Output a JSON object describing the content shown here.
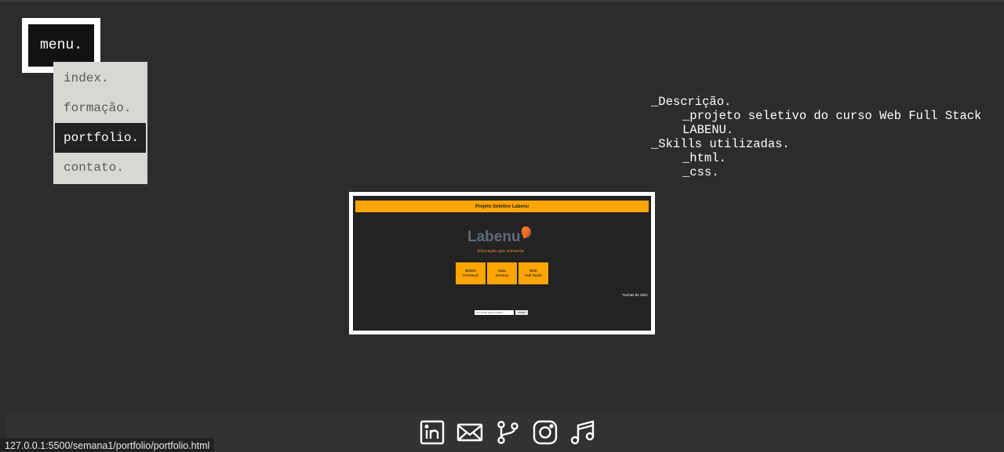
{
  "menu": {
    "button_label": "menu.",
    "items": [
      {
        "label": "index.",
        "active": false
      },
      {
        "label": "formação.",
        "active": false
      },
      {
        "label": "portfolio.",
        "active": true
      },
      {
        "label": "contato.",
        "active": false
      }
    ]
  },
  "description": {
    "heading": "_Descrição.",
    "line1": "_projeto seletivo do curso Web Full Stack",
    "line2": "LABENU.",
    "skills_heading": "_Skills utilizadas.",
    "skill1": "_html.",
    "skill2": "_css."
  },
  "preview": {
    "header_title": "Projeto Seletivo Labenu",
    "logo_text": "Labenu",
    "tagline": "Educação que reinventa",
    "buttons": [
      {
        "line1": "Mobile",
        "line2": "Frontend"
      },
      {
        "line1": "Data",
        "line2": "Science"
      },
      {
        "line1": "Web",
        "line2": "Full Stack"
      }
    ],
    "turmas": "Turmas de 2021",
    "email_placeholder": "seu email para contato",
    "send_label": "enviar"
  },
  "footer": {
    "icons": [
      "linkedin-icon",
      "mail-icon",
      "git-branch-icon",
      "instagram-icon",
      "music-icon"
    ]
  },
  "status_bar": {
    "url": "127.0.0.1:5500/semana1/portfolio/portfolio.html"
  },
  "colors": {
    "background": "#2b2c2b",
    "accent": "#ffa500",
    "footer": "#303233"
  }
}
